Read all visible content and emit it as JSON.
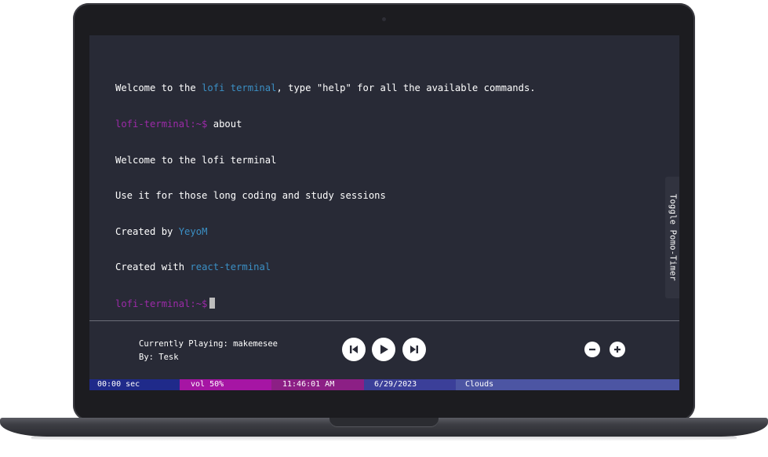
{
  "terminal": {
    "welcome_prefix": "Welcome to the ",
    "welcome_link": "lofi terminal",
    "welcome_suffix": ", type \"help\" for all the available commands.",
    "prompt": "lofi-terminal:~$",
    "command": "about",
    "output_line_1": "Welcome to the lofi terminal",
    "output_line_2": "Use it for those long coding and study sessions",
    "created_by_prefix": "Created by ",
    "created_by_link": "YeyoM",
    "created_with_prefix": "Created with ",
    "created_with_link": "react-terminal"
  },
  "pomo": {
    "toggle_label": "Toggle Pomo-Timer"
  },
  "player": {
    "currently_playing": "Currently Playing: makemesee",
    "by": "By: Tesk",
    "icons": {
      "previous": "skip-previous-icon",
      "play": "play-icon",
      "next": "skip-next-icon",
      "volume_down": "minus-icon",
      "volume_up": "plus-icon"
    }
  },
  "status_bar": {
    "timer": "00:00 sec",
    "volume": "vol 50%",
    "time": "11:46:01 AM",
    "date": "6/29/2023",
    "weather": "Clouds"
  },
  "colors": {
    "terminal_bg": "#282a36",
    "prompt": "#9c2aa8",
    "link": "#3b8fc4",
    "status_timer": "#1f2a8a",
    "status_volume": "#a615a4",
    "status_time": "#8c1f85",
    "status_date": "#3b3f99",
    "status_weather": "#4c55a3"
  }
}
